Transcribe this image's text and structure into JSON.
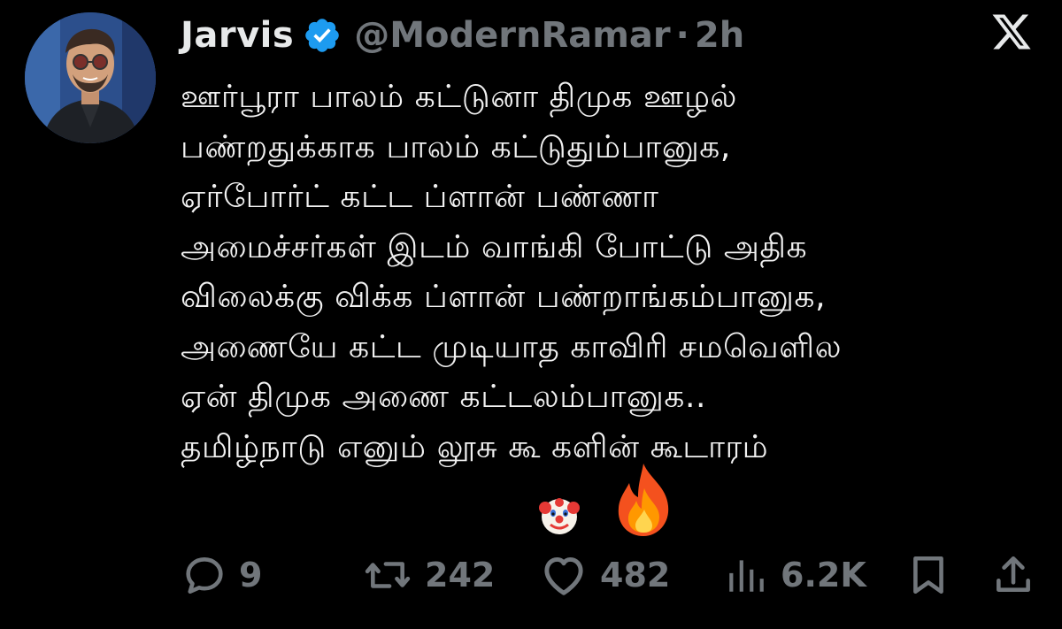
{
  "author": {
    "display_name": "Jarvis",
    "handle": "@ModernRamar",
    "separator": "·",
    "time": "2h",
    "verified": true,
    "avatar_icon": "avatar-photo"
  },
  "platform_icon": "x-logo-icon",
  "text_lines": [
    "ஊர்பூரா பாலம் கட்டுனா திமுக ஊழல்",
    "பண்றதுக்காக பாலம் கட்டுதும்பானுக,",
    "ஏர்போர்ட் கட்ட ப்ளான் பண்ணா",
    "அமைச்சர்கள் இடம் வாங்கி போட்டு அதிக",
    "விலைக்கு விக்க ப்ளான் பண்றாங்கம்பானுக,",
    "அணையே கட்ட முடியாத காவிரி சமவெளில",
    "ஏன் திமுக அணை கட்டலம்பானுக..",
    "தமிழ்நாடு எனும் லூசு கூ   களின் கூடாரம்"
  ],
  "emojis": [
    "clown-emoji",
    "fire-emoji"
  ],
  "actions": {
    "replies": "9",
    "reposts": "242",
    "likes": "482",
    "views": "6.2K"
  },
  "colors": {
    "background": "#000000",
    "text": "#e7e9ea",
    "muted": "#71767b",
    "verified_blue": "#1d9bf0"
  }
}
